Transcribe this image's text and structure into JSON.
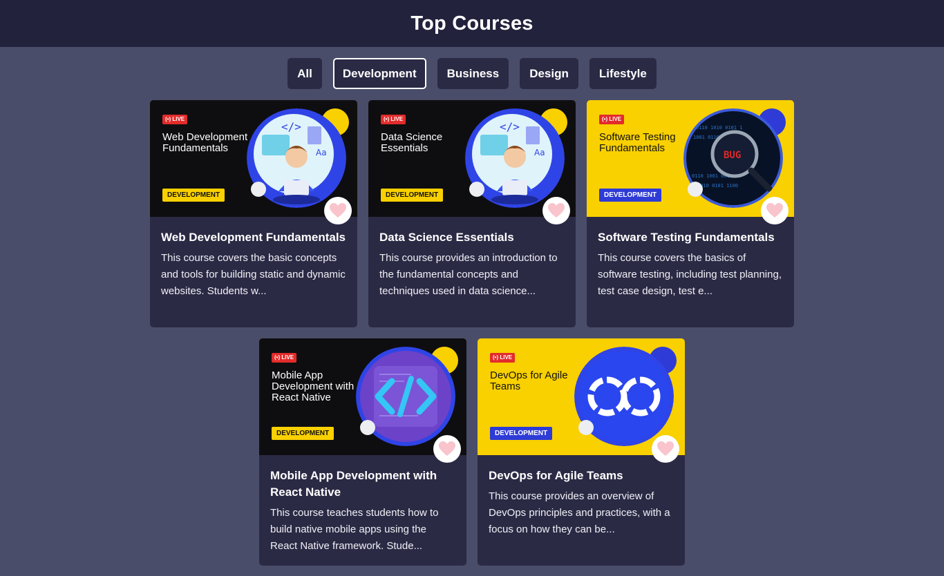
{
  "header": {
    "title": "Top Courses"
  },
  "filters": [
    {
      "label": "All"
    },
    {
      "label": "Development"
    },
    {
      "label": "Business"
    },
    {
      "label": "Design"
    },
    {
      "label": "Lifestyle"
    }
  ],
  "active_filter": "Development",
  "live_label": "LIVE",
  "courses": [
    {
      "thumb_title": "Web Development Fundamentals",
      "tag": "DEVELOPMENT",
      "title": "Web Development Fundamentals",
      "description": "This course covers the basic concepts and tools for building static and dynamic websites. Students w...",
      "theme": "dark",
      "illustration": "developer-at-laptop-icon"
    },
    {
      "thumb_title": "Data Science Essentials",
      "tag": "DEVELOPMENT",
      "title": "Data Science Essentials",
      "description": "This course provides an introduction to the fundamental concepts and techniques used in data science...",
      "theme": "dark",
      "illustration": "developer-at-laptop-icon"
    },
    {
      "thumb_title": "Software Testing Fundamentals",
      "tag": "DEVELOPMENT",
      "title": "Software Testing Fundamentals",
      "description": "This course covers the basics of software testing, including test planning, test case design, test e...",
      "theme": "yellow",
      "illustration": "bug-magnifier-icon",
      "bug_text": "BUG"
    },
    {
      "thumb_title": "Mobile App Development with React Native",
      "tag": "DEVELOPMENT",
      "title": "Mobile App Development with React Native",
      "description": "This course teaches students how to build native mobile apps using the React Native framework. Stude...",
      "theme": "dark",
      "illustration": "code-brackets-icon"
    },
    {
      "thumb_title": "DevOps for Agile Teams",
      "tag": "DEVELOPMENT",
      "title": "DevOps for Agile Teams",
      "description": "This course provides an overview of DevOps principles and practices, with a focus on how they can be...",
      "theme": "yellow",
      "illustration": "infinity-loop-icon"
    }
  ],
  "colors": {
    "page_bg": "#4a4d69",
    "header_bg": "#23223c",
    "card_bg": "#2b2a45",
    "accent_yellow": "#f9d000",
    "accent_blue": "#2e3bd6",
    "live_red": "#e32b2b",
    "heart_pink": "#f9c4cc"
  }
}
